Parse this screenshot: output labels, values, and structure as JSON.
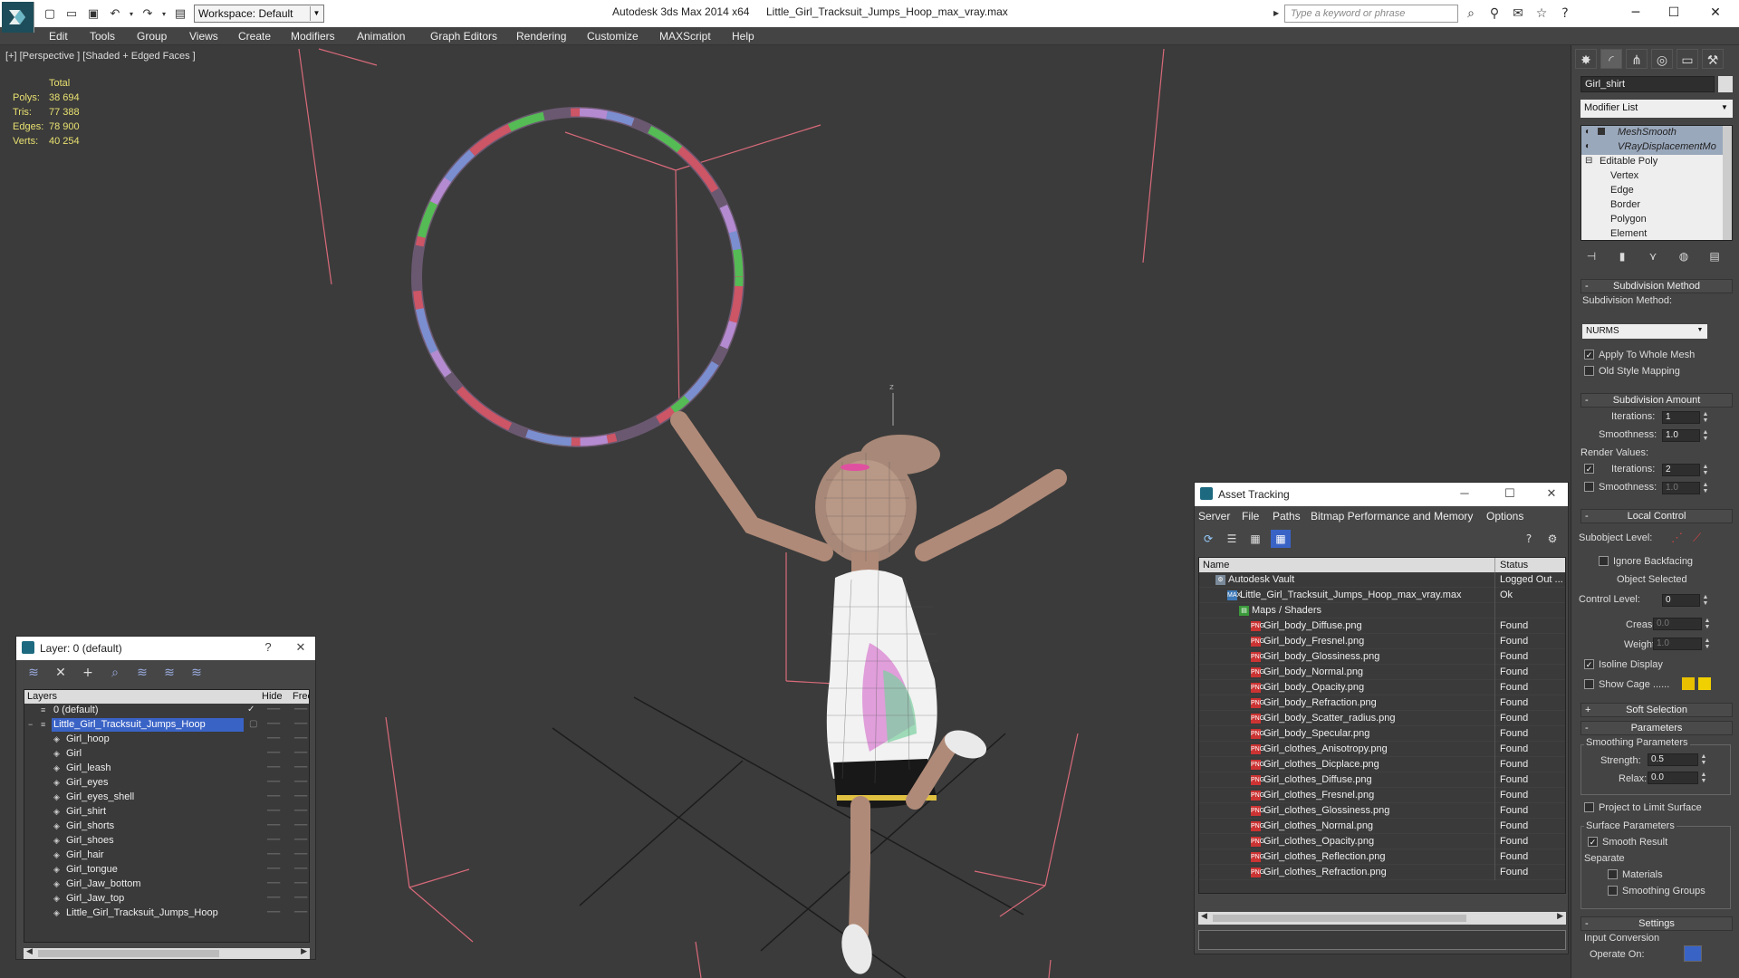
{
  "window": {
    "app_title": "Autodesk 3ds Max  2014 x64",
    "file_title": "Little_Girl_Tracksuit_Jumps_Hoop_max_vray.max",
    "workspace": "Workspace: Default",
    "search_placeholder": "Type a keyword or phrase",
    "minimize": "─",
    "maximize": "☐",
    "close": "✕"
  },
  "menu": [
    "Edit",
    "Tools",
    "Group",
    "Views",
    "Create",
    "Modifiers",
    "Animation",
    "Graph Editors",
    "Rendering",
    "Customize",
    "MAXScript",
    "Help"
  ],
  "viewport": {
    "label": "[+] [Perspective ] [Shaded + Edged Faces ]",
    "stats": {
      "header": "Total",
      "rows": [
        {
          "k": "Polys:",
          "v": "38 694"
        },
        {
          "k": "Tris:",
          "v": "77 388"
        },
        {
          "k": "Edges:",
          "v": "78 900"
        },
        {
          "k": "Verts:",
          "v": "40 254"
        }
      ]
    },
    "gizmo_label": "z"
  },
  "layer_panel": {
    "title": "Layer: 0 (default)",
    "help": "?",
    "close": "✕",
    "col_layers": "Layers",
    "col_hide": "Hide",
    "col_freeze": "Free",
    "rows": [
      {
        "name": "0 (default)",
        "level": 0,
        "check": "✓"
      },
      {
        "name": "Little_Girl_Tracksuit_Jumps_Hoop",
        "level": 0,
        "selected": true
      },
      {
        "name": "Girl_hoop",
        "level": 1
      },
      {
        "name": "Girl",
        "level": 1
      },
      {
        "name": "Girl_leash",
        "level": 1
      },
      {
        "name": "Girl_eyes",
        "level": 1
      },
      {
        "name": "Girl_eyes_shell",
        "level": 1
      },
      {
        "name": "Girl_shirt",
        "level": 1
      },
      {
        "name": "Girl_shorts",
        "level": 1
      },
      {
        "name": "Girl_shoes",
        "level": 1
      },
      {
        "name": "Girl_hair",
        "level": 1
      },
      {
        "name": "Girl_tongue",
        "level": 1
      },
      {
        "name": "Girl_Jaw_bottom",
        "level": 1
      },
      {
        "name": "Girl_Jaw_top",
        "level": 1
      },
      {
        "name": "Little_Girl_Tracksuit_Jumps_Hoop",
        "level": 1
      }
    ]
  },
  "asset_panel": {
    "title": "Asset Tracking",
    "minimize": "─",
    "maximize": "☐",
    "close": "✕",
    "menu": [
      "Server",
      "File",
      "Paths",
      "Bitmap Performance and Memory",
      "Options"
    ],
    "col_name": "Name",
    "col_status": "Status",
    "rows": [
      {
        "name": "Autodesk Vault",
        "status": "Logged Out ...",
        "level": 0,
        "icon": "vault"
      },
      {
        "name": "Little_Girl_Tracksuit_Jumps_Hoop_max_vray.max",
        "status": "Ok",
        "level": 1,
        "icon": "max"
      },
      {
        "name": "Maps / Shaders",
        "status": "",
        "level": 2,
        "icon": "folder"
      },
      {
        "name": "Girl_body_Diffuse.png",
        "status": "Found",
        "level": 3,
        "icon": "png"
      },
      {
        "name": "Girl_body_Fresnel.png",
        "status": "Found",
        "level": 3,
        "icon": "png"
      },
      {
        "name": "Girl_body_Glossiness.png",
        "status": "Found",
        "level": 3,
        "icon": "png"
      },
      {
        "name": "Girl_body_Normal.png",
        "status": "Found",
        "level": 3,
        "icon": "png"
      },
      {
        "name": "Girl_body_Opacity.png",
        "status": "Found",
        "level": 3,
        "icon": "png"
      },
      {
        "name": "Girl_body_Refraction.png",
        "status": "Found",
        "level": 3,
        "icon": "png"
      },
      {
        "name": "Girl_body_Scatter_radius.png",
        "status": "Found",
        "level": 3,
        "icon": "png"
      },
      {
        "name": "Girl_body_Specular.png",
        "status": "Found",
        "level": 3,
        "icon": "png"
      },
      {
        "name": "Girl_clothes_Anisotropy.png",
        "status": "Found",
        "level": 3,
        "icon": "png"
      },
      {
        "name": "Girl_clothes_Dicplace.png",
        "status": "Found",
        "level": 3,
        "icon": "png"
      },
      {
        "name": "Girl_clothes_Diffuse.png",
        "status": "Found",
        "level": 3,
        "icon": "png"
      },
      {
        "name": "Girl_clothes_Fresnel.png",
        "status": "Found",
        "level": 3,
        "icon": "png"
      },
      {
        "name": "Girl_clothes_Glossiness.png",
        "status": "Found",
        "level": 3,
        "icon": "png"
      },
      {
        "name": "Girl_clothes_Normal.png",
        "status": "Found",
        "level": 3,
        "icon": "png"
      },
      {
        "name": "Girl_clothes_Opacity.png",
        "status": "Found",
        "level": 3,
        "icon": "png"
      },
      {
        "name": "Girl_clothes_Reflection.png",
        "status": "Found",
        "level": 3,
        "icon": "png"
      },
      {
        "name": "Girl_clothes_Refraction.png",
        "status": "Found",
        "level": 3,
        "icon": "png"
      }
    ]
  },
  "command_panel": {
    "object_name": "Girl_shirt",
    "modifier_list": "Modifier List",
    "stack": [
      {
        "name": "MeshSmooth",
        "italic": true,
        "level": 0
      },
      {
        "name": "VRayDisplacementMo",
        "italic": true,
        "level": 0
      },
      {
        "name": "Editable Poly",
        "level": 0
      },
      {
        "name": "Vertex",
        "level": 1
      },
      {
        "name": "Edge",
        "level": 1
      },
      {
        "name": "Border",
        "level": 1
      },
      {
        "name": "Polygon",
        "level": 1
      },
      {
        "name": "Element",
        "level": 1
      }
    ],
    "subdivision_method_title": "Subdivision Method",
    "subdivision_method_label": "Subdivision Method:",
    "subdivision_method_value": "NURMS",
    "apply_whole_mesh": "Apply To Whole Mesh",
    "old_style_mapping": "Old Style Mapping",
    "subdivision_amount_title": "Subdivision Amount",
    "iterations_label": "Iterations:",
    "iterations_value": "1",
    "smoothness_label": "Smoothness:",
    "smoothness_value": "1.0",
    "render_values": "Render Values:",
    "render_iterations_value": "2",
    "render_smoothness_value": "1.0",
    "local_control_title": "Local Control",
    "subobject_level": "Subobject Level:",
    "ignore_backfacing": "Ignore Backfacing",
    "object_selected": "Object Selected",
    "control_level": "Control Level:",
    "control_level_value": "0",
    "crease_label": "Crease:",
    "crease_value": "0.0",
    "weight_label": "Weight:",
    "weight_value": "1.0",
    "isoline_display": "Isoline Display",
    "show_cage": "Show Cage ......",
    "soft_selection_title": "Soft Selection",
    "parameters_title": "Parameters",
    "smoothing_parameters": "Smoothing Parameters",
    "strength_label": "Strength:",
    "strength_value": "0.5",
    "relax_label": "Relax:",
    "relax_value": "0.0",
    "project_limit": "Project to Limit Surface",
    "surface_parameters": "Surface Parameters",
    "smooth_result": "Smooth Result",
    "separate": "Separate",
    "materials": "Materials",
    "smoothing_groups": "Smoothing Groups",
    "settings_title": "Settings",
    "input_conversion": "Input Conversion",
    "operate_on": "Operate On:"
  }
}
